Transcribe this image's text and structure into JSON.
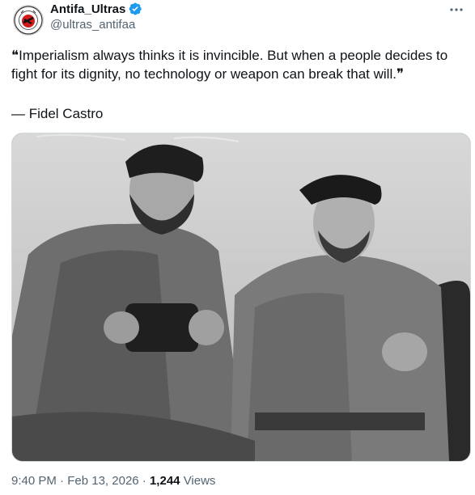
{
  "tweet": {
    "author": {
      "display_name": "Antifa_Ultras",
      "handle": "@ultras_antifaa",
      "verified": true,
      "verified_color": "#1d9bf0",
      "avatar_logo_text": "ANTIFA"
    },
    "more_icon": "more-horizontal-icon",
    "text": "❝Imperialism always thinks it is invincible. But when a people decides to\nfight for its dignity, no technology or weapon can break that will.❞",
    "attribution": "— Fidel Castro",
    "media": {
      "kind": "black-and-white photograph",
      "subject": "two men in berets and fatigues, one holding binoculars"
    },
    "meta": {
      "time": "9:40 PM",
      "separator": "·",
      "date": "Feb 13, 2026",
      "views_count": "1,244",
      "views_label": "Views"
    }
  }
}
